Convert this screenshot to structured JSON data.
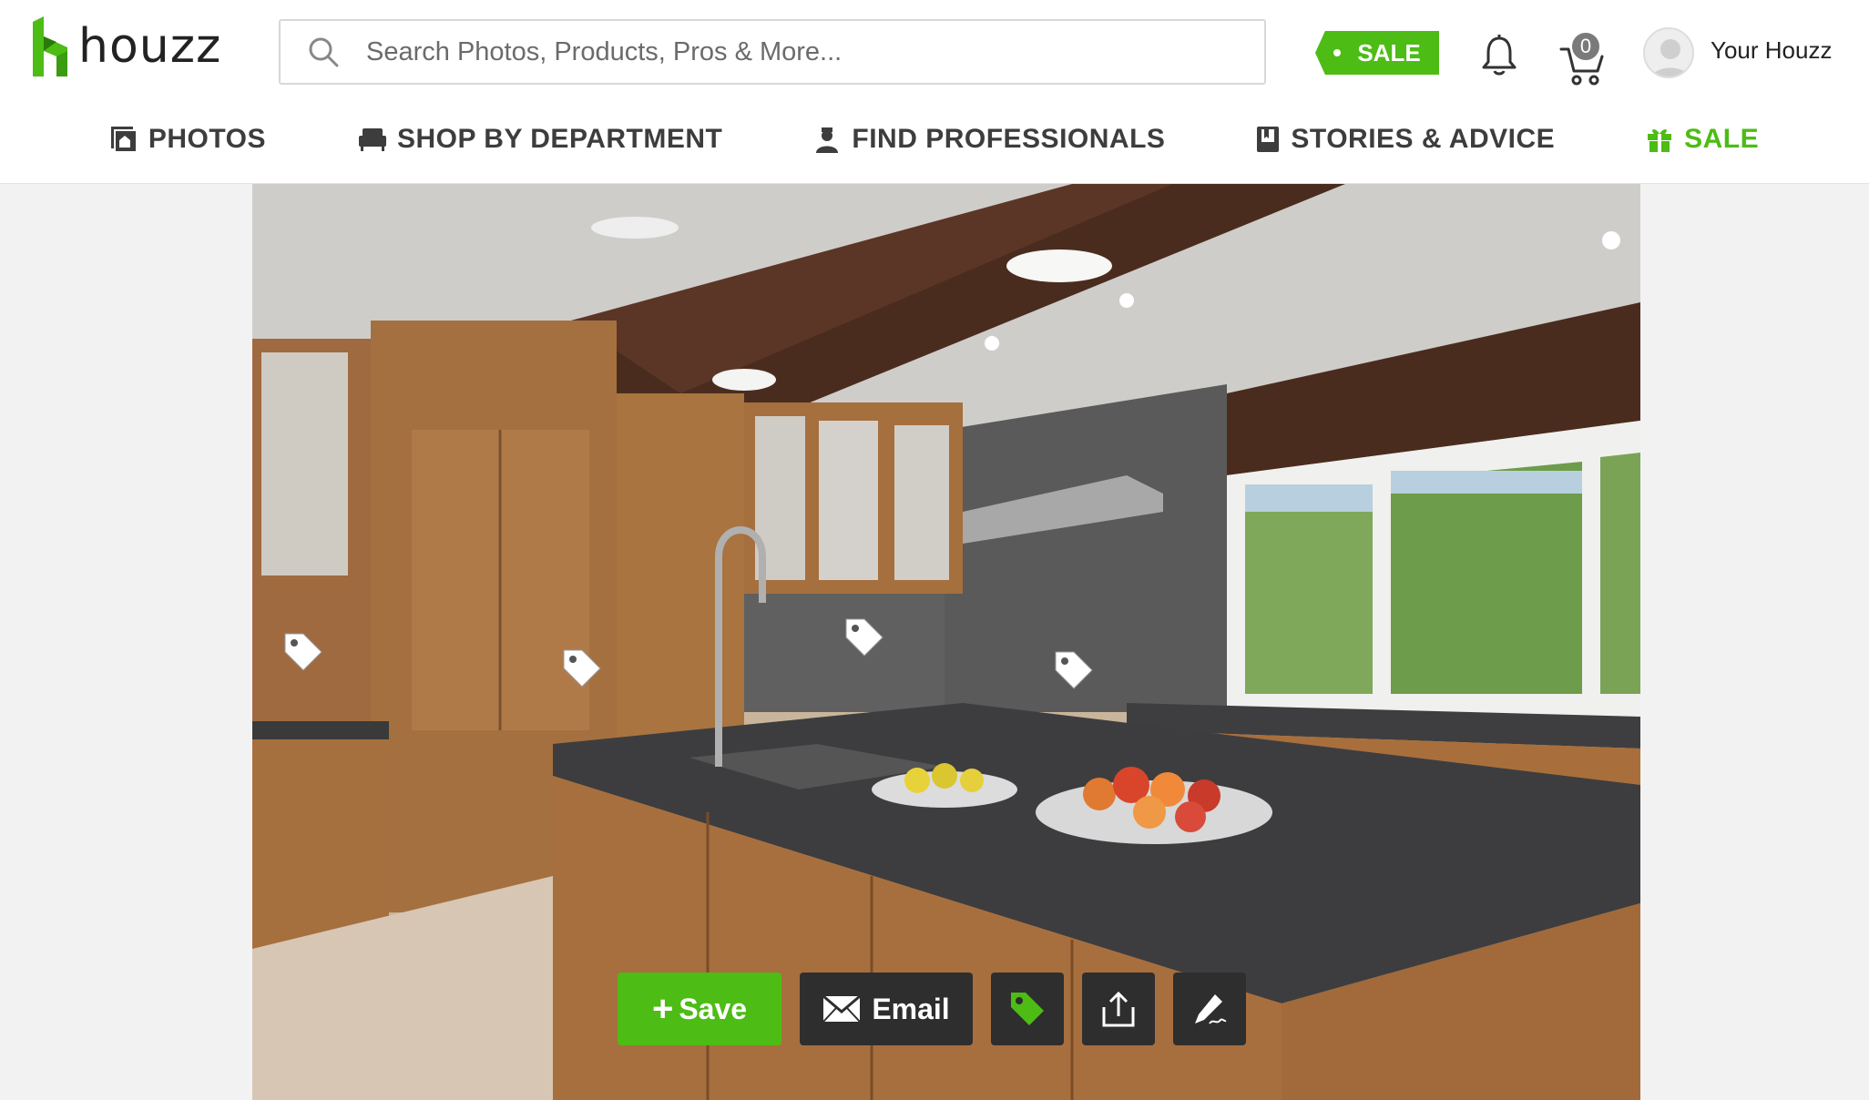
{
  "brand": {
    "name": "houzz",
    "accent": "#4dbc15"
  },
  "search": {
    "placeholder": "Search Photos, Products, Pros & More..."
  },
  "header": {
    "sale_badge": "SALE",
    "cart_count": "0",
    "user_label": "Your Houzz",
    "icons": [
      "bell-icon",
      "cart-icon",
      "avatar"
    ]
  },
  "nav": [
    {
      "label": "PHOTOS",
      "icon": "photos-icon"
    },
    {
      "label": "SHOP BY DEPARTMENT",
      "icon": "sofa-icon"
    },
    {
      "label": "FIND PROFESSIONALS",
      "icon": "professional-icon"
    },
    {
      "label": "STORIES & ADVICE",
      "icon": "book-icon"
    },
    {
      "label": "SALE",
      "icon": "gift-icon"
    }
  ],
  "photo": {
    "product_tags": 5
  },
  "actions": {
    "save_label": "Save",
    "email_label": "Email",
    "icons": [
      "tag-icon",
      "share-icon",
      "edit-icon"
    ]
  }
}
